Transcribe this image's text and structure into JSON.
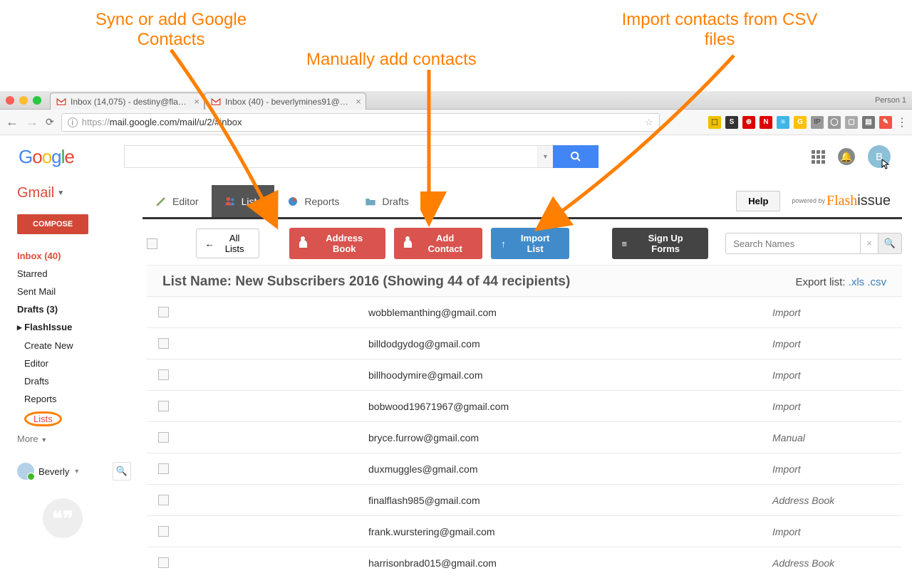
{
  "annotations": {
    "sync": "Sync or add Google\nContacts",
    "manual": "Manually add contacts",
    "import": "Import contacts from CSV\nfiles"
  },
  "browser": {
    "person": "Person 1",
    "tabs": [
      {
        "title": "Inbox (14,075) - destiny@fla…"
      },
      {
        "title": "Inbox (40) - beverlymines91@…"
      }
    ],
    "url_prefix": "https://",
    "url_main": "mail.google.com/mail/u/2/#inbox"
  },
  "google": {
    "apps_tip": "Apps"
  },
  "gmail": {
    "label": "Gmail",
    "compose": "COMPOSE",
    "nav": {
      "inbox": "Inbox (40)",
      "starred": "Starred",
      "sent": "Sent Mail",
      "drafts": "Drafts (3)",
      "flashissue": "FlashIssue",
      "create": "Create New",
      "editor": "Editor",
      "fi_drafts": "Drafts",
      "reports": "Reports",
      "lists": "Lists",
      "more": "More"
    },
    "user": "Beverly"
  },
  "flashissue": {
    "tabs": {
      "editor": "Editor",
      "lists": "Lists",
      "reports": "Reports",
      "drafts": "Drafts"
    },
    "help": "Help",
    "powered": "powered by"
  },
  "toolbar": {
    "all_lists": "All Lists",
    "address_book": "Address Book",
    "add_contact": "Add Contact",
    "import_list": "Import List",
    "signup": "Sign Up Forms",
    "search_placeholder": "Search Names"
  },
  "list": {
    "title": "List Name: New Subscribers 2016 (Showing 44 of 44 recipients)",
    "export_label": "Export list:",
    "export_xls": ".xls",
    "export_csv": ".csv"
  },
  "rows": [
    {
      "email": "wobblemanthing@gmail.com",
      "src": "Import"
    },
    {
      "email": "billdodgydog@gmail.com",
      "src": "Import"
    },
    {
      "email": "billhoodymire@gmail.com",
      "src": "Import"
    },
    {
      "email": "bobwood19671967@gmail.com",
      "src": "Import"
    },
    {
      "email": "bryce.furrow@gmail.com",
      "src": "Manual"
    },
    {
      "email": "duxmuggles@gmail.com",
      "src": "Import"
    },
    {
      "email": "finalflash985@gmail.com",
      "src": "Address Book"
    },
    {
      "email": "frank.wurstering@gmail.com",
      "src": "Import"
    },
    {
      "email": "harrisonbrad015@gmail.com",
      "src": "Address Book"
    }
  ]
}
